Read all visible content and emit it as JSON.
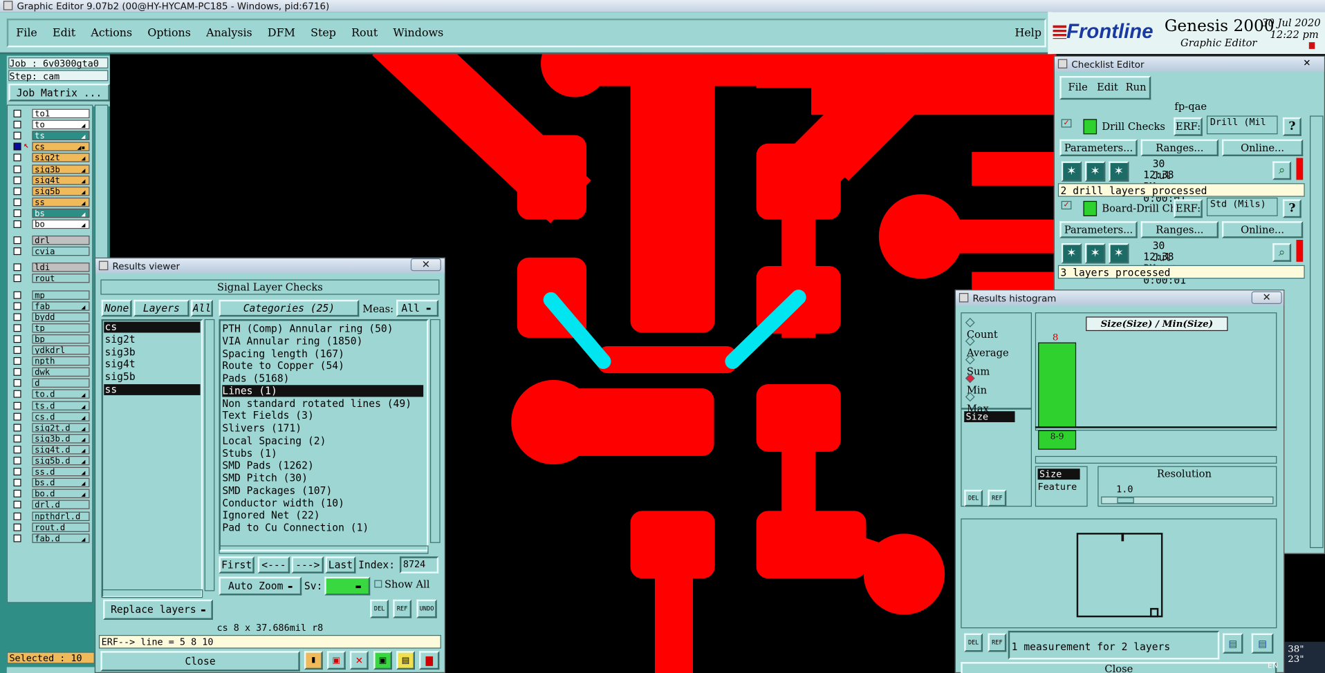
{
  "window": {
    "title": "Graphic Editor 9.07b2 (00@HY-HYCAM-PC185 - Windows, pid:6716)"
  },
  "menu": {
    "items": [
      "File",
      "Edit",
      "Actions",
      "Options",
      "Analysis",
      "DFM",
      "Step",
      "Rout",
      "Windows"
    ],
    "help": "Help"
  },
  "brand": {
    "logo": "Frontline",
    "product": "Genesis 2000",
    "subtitle": "Graphic Editor",
    "date": "30 Jul 2020",
    "time": "12:22 pm"
  },
  "job": {
    "job_label": "Job : 6v0300gta0",
    "step_label": "Step: cam",
    "matrix_button": "Job Matrix ...",
    "selected": "Selected : 10"
  },
  "layers": [
    {
      "name": "to1",
      "style": "w",
      "mark": ""
    },
    {
      "name": "to",
      "style": "w",
      "mark": "◢"
    },
    {
      "name": "ts",
      "style": "t",
      "mark": "◢"
    },
    {
      "name": "cs",
      "style": "y",
      "mark": "◢▪",
      "active": true
    },
    {
      "name": "sig2t",
      "style": "y",
      "mark": "◢"
    },
    {
      "name": "sig3b",
      "style": "y",
      "mark": "◢"
    },
    {
      "name": "sig4t",
      "style": "y",
      "mark": "◢"
    },
    {
      "name": "sig5b",
      "style": "y",
      "mark": "◢"
    },
    {
      "name": "ss",
      "style": "y",
      "mark": "◢"
    },
    {
      "name": "bs",
      "style": "t",
      "mark": "◢"
    },
    {
      "name": "bo",
      "style": "w",
      "mark": "◢"
    },
    {
      "name": "drl",
      "style": "g",
      "mark": ""
    },
    {
      "name": "cvia",
      "style": "c",
      "mark": ""
    },
    {
      "name": "ldi",
      "style": "g",
      "mark": ""
    },
    {
      "name": "rout",
      "style": "c",
      "mark": ""
    },
    {
      "name": "mp",
      "style": "c",
      "mark": ""
    },
    {
      "name": "fab",
      "style": "c",
      "mark": "◢"
    },
    {
      "name": "bydd",
      "style": "c",
      "mark": ""
    },
    {
      "name": "tp",
      "style": "c",
      "mark": ""
    },
    {
      "name": "bp",
      "style": "c",
      "mark": ""
    },
    {
      "name": "ydkdrl",
      "style": "c",
      "mark": ""
    },
    {
      "name": "npth",
      "style": "c",
      "mark": ""
    },
    {
      "name": "dwk",
      "style": "c",
      "mark": ""
    },
    {
      "name": "d",
      "style": "c",
      "mark": ""
    },
    {
      "name": "to.d",
      "style": "c",
      "mark": "◢"
    },
    {
      "name": "ts.d",
      "style": "c",
      "mark": "◢"
    },
    {
      "name": "cs.d",
      "style": "c",
      "mark": "◢"
    },
    {
      "name": "sig2t.d",
      "style": "c",
      "mark": "◢"
    },
    {
      "name": "sig3b.d",
      "style": "c",
      "mark": "◢"
    },
    {
      "name": "sig4t.d",
      "style": "c",
      "mark": "◢"
    },
    {
      "name": "sig5b.d",
      "style": "c",
      "mark": "◢"
    },
    {
      "name": "ss.d",
      "style": "c",
      "mark": "◢"
    },
    {
      "name": "bs.d",
      "style": "c",
      "mark": "◢"
    },
    {
      "name": "bo.d",
      "style": "c",
      "mark": "◢"
    },
    {
      "name": "drl.d",
      "style": "c",
      "mark": ""
    },
    {
      "name": "npthdrl.d",
      "style": "c",
      "mark": ""
    },
    {
      "name": "rout.d",
      "style": "c",
      "mark": ""
    },
    {
      "name": "fab.d",
      "style": "c",
      "mark": "◢"
    }
  ],
  "results_viewer": {
    "title": "Results viewer",
    "header": "Signal Layer Checks",
    "none_btn": "None",
    "layers_btn": "Layers",
    "all_btn": "All",
    "categories_btn": "Categories (25)",
    "meas_label": "Meas:",
    "meas_value": "All",
    "layers_list": [
      "cs",
      "sig2t",
      "sig3b",
      "sig4t",
      "sig5b",
      "ss"
    ],
    "categories": [
      "PTH (Comp) Annular ring (50)",
      "VIA Annular ring (1850)",
      "Spacing length (167)",
      "Route to Copper (54)",
      "Pads (5168)",
      "Lines (1)",
      "Non standard rotated lines (49)",
      "Text Fields (3)",
      "Slivers (171)",
      "Local Spacing (2)",
      "Stubs (1)",
      "SMD Pads (1262)",
      "SMD Pitch (30)",
      "SMD Packages (107)",
      "Conductor width (10)",
      "Ignored Net (22)",
      "Pad to Cu Connection (1)"
    ],
    "selected_category": 5,
    "nav": {
      "first": "First",
      "prev": "<---",
      "next": "--->",
      "last": "Last",
      "index_label": "Index:",
      "index_value": "8724"
    },
    "auto_zoom": "Auto Zoom",
    "sv_label": "Sv:",
    "show_all": "Show All",
    "replace_layers": "Replace layers",
    "del": "DEL",
    "ref": "REF",
    "undo": "UNDO",
    "status": "cs 8 x 37.686mil  r8",
    "erf_line": "ERF--> line = 5 8 10",
    "close": "Close"
  },
  "checklist": {
    "title": "Checklist Editor",
    "menu": [
      "File",
      "Edit",
      "Run"
    ],
    "name": "fp-qae",
    "checks": [
      {
        "name": "Drill Checks",
        "erf_label": "ERF:",
        "erf_value": "Drill (Mil",
        "params": "Parameters...",
        "ranges": "Ranges...",
        "online": "Online...",
        "date": "30 Jul 2020",
        "time": "12:38 PM - 0:00:01",
        "status": "2 drill layers processed"
      },
      {
        "name": "Board-Drill Che",
        "erf_label": "ERF:",
        "erf_value": "Std (Mils)",
        "params": "Parameters...",
        "ranges": "Ranges...",
        "online": "Online...",
        "date": "30 Jul 2020",
        "time": "12:38 PM - 0:00:01",
        "status": "3 layers processed"
      }
    ],
    "help": "?"
  },
  "histogram": {
    "title": "Results histogram",
    "modes": [
      "Count",
      "Average",
      "Sum",
      "Min",
      "Max"
    ],
    "selected_mode": "Min",
    "list_item": "Size",
    "chart_title": "Size(Size) / Min(Size)",
    "bar_value": "8",
    "bar_label": "8-9",
    "resolution_label": "Resolution",
    "resolution_value": "1.0",
    "size_label": "Size",
    "feature_label": "Feature",
    "footer": "1 measurement for 2 layers",
    "close": "Close",
    "del": "DEL",
    "ref": "REF"
  },
  "tray": {
    "lang": "EN",
    "time_frag": "38\"",
    "time_frag2": "23\""
  },
  "colors": {
    "teal": "#9ed6d3",
    "copper": "#ff0000",
    "highlight": "#00e5f0",
    "yellow": "#f0ba5a"
  }
}
